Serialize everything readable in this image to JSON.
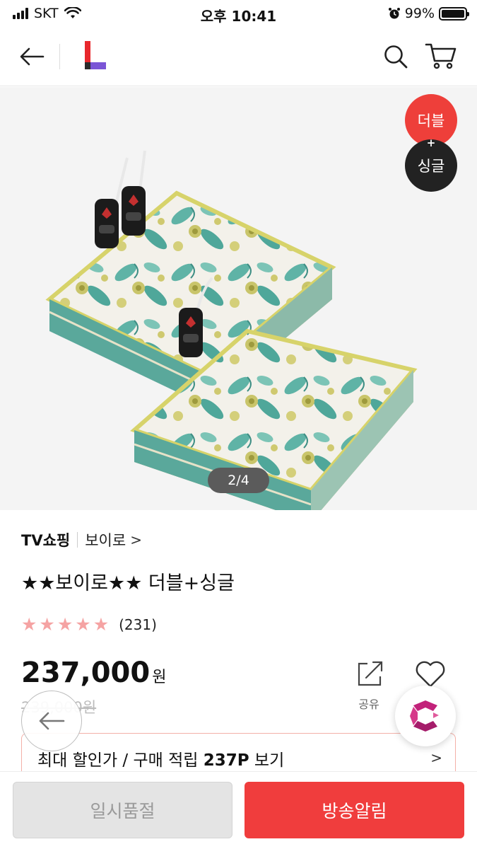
{
  "status_bar": {
    "carrier": "SKT",
    "time": "오후 10:41",
    "battery": "99%",
    "icons": [
      "signal-icon",
      "wifi-icon",
      "alarm-icon",
      "battery-icon"
    ]
  },
  "header": {
    "icons": [
      "back-arrow-icon",
      "lotte-logo",
      "search-icon",
      "cart-icon"
    ]
  },
  "gallery": {
    "badge_top": "더블",
    "badge_plus": "+",
    "badge_bottom": "싱글",
    "page_indicator": "2/4"
  },
  "product": {
    "seller": "TV쇼핑",
    "brand": "보이로",
    "brand_chevron": ">",
    "title": "★★보이로★★ 더블+싱글",
    "rating_stars": 5,
    "review_count": "(231)",
    "price": "237,000",
    "price_unit": "원",
    "original_price": "239,000원",
    "share_label": "공유"
  },
  "benefit": {
    "prefix": "최대 할인가 / 구매 적립 ",
    "points": "237P",
    "suffix": " 보기",
    "chevron": ">"
  },
  "bottom_bar": {
    "soldout_label": "일시품절",
    "notify_label": "방송알림"
  },
  "colors": {
    "accent_red": "#f03d3d",
    "badge_red": "#ee3f3a",
    "badge_black": "#222222",
    "star_pink": "#f5a3a3",
    "benefit_border": "#f3b0a8"
  }
}
